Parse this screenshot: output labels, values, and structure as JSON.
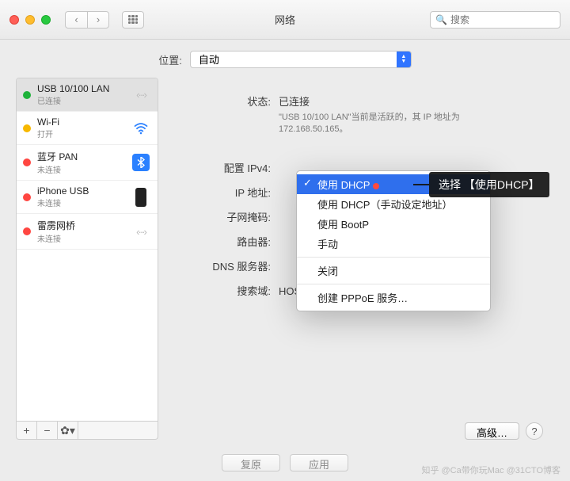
{
  "window": {
    "title": "网络"
  },
  "search": {
    "placeholder": "搜索"
  },
  "location": {
    "label": "位置:",
    "value": "自动"
  },
  "services": [
    {
      "name": "USB 10/100 LAN",
      "status_text": "已连接",
      "dot": "green",
      "icon": "ethernet",
      "selected": true
    },
    {
      "name": "Wi-Fi",
      "status_text": "打开",
      "dot": "yellow",
      "icon": "wifi",
      "selected": false
    },
    {
      "name": "蓝牙 PAN",
      "status_text": "未连接",
      "dot": "red",
      "icon": "bluetooth",
      "selected": false
    },
    {
      "name": "iPhone USB",
      "status_text": "未连接",
      "dot": "red",
      "icon": "iphone",
      "selected": false
    },
    {
      "name": "雷雳网桥",
      "status_text": "未连接",
      "dot": "red",
      "icon": "thunderbolt",
      "selected": false
    }
  ],
  "detail": {
    "status_label": "状态:",
    "status_value": "已连接",
    "status_sub": "\"USB 10/100 LAN\"当前是活跃的，其 IP 地址为 172.168.50.165。",
    "ipv4_label": "配置 IPv4:",
    "ip_label": "IP 地址:",
    "subnet_label": "子网掩码:",
    "router_label": "路由器:",
    "dns_label": "DNS 服务器:",
    "search_label": "搜索域:",
    "search_value": "HOST、DHCP",
    "advanced_btn": "高级…"
  },
  "popup": {
    "items": [
      {
        "label": "使用 DHCP",
        "selected": true
      },
      {
        "label": "使用 DHCP（手动设定地址）",
        "selected": false
      },
      {
        "label": "使用 BootP",
        "selected": false
      },
      {
        "label": "手动",
        "selected": false
      }
    ],
    "sep_after": 3,
    "items2": [
      {
        "label": "关闭"
      }
    ],
    "items3": [
      {
        "label": "创建 PPPoE 服务…"
      }
    ]
  },
  "annotation": "选择 【使用DHCP】",
  "buttons": {
    "revert": "复原",
    "apply": "应用"
  },
  "watermark": "知乎 @Ca带你玩Mac  @31CTO博客"
}
